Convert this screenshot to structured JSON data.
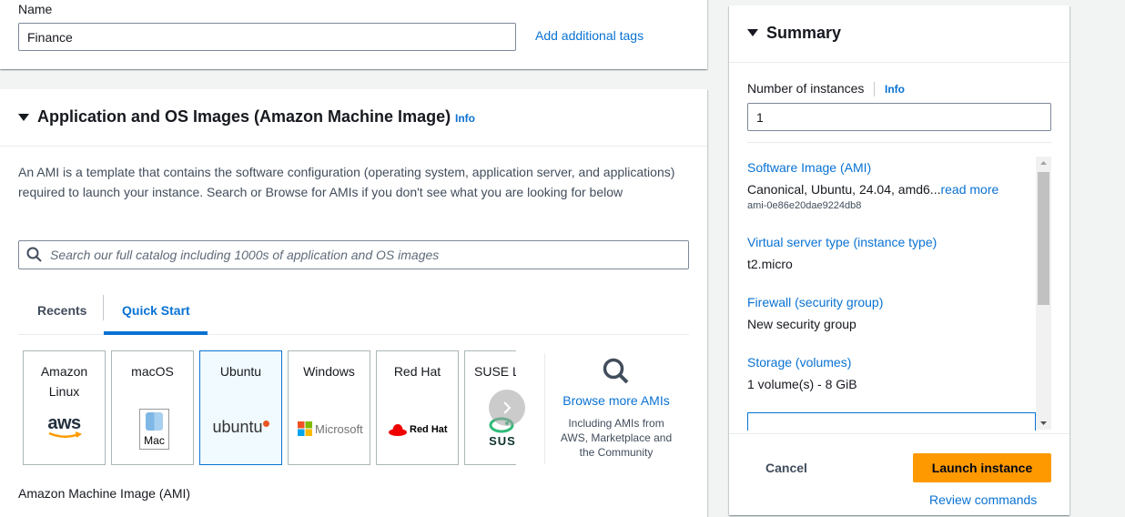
{
  "name_section": {
    "label": "Name",
    "value": "Finance",
    "add_tags": "Add additional tags"
  },
  "ami_section": {
    "title": "Application and OS Images (Amazon Machine Image)",
    "info": "Info",
    "description": "An AMI is a template that contains the software configuration (operating system, application server, and applications) required to launch your instance. Search or Browse for AMIs if you don't see what you are looking for below",
    "search_placeholder": "Search our full catalog including 1000s of application and OS images",
    "tabs": [
      {
        "label": "Recents"
      },
      {
        "label": "Quick Start"
      }
    ],
    "tiles": [
      {
        "name": "Amazon Linux",
        "logo": "aws"
      },
      {
        "name": "macOS",
        "logo": "Mac"
      },
      {
        "name": "Ubuntu",
        "logo": "ubuntu"
      },
      {
        "name": "Windows",
        "logo": "Microsoft"
      },
      {
        "name": "Red Hat",
        "logo": "Red Hat"
      },
      {
        "name": "SUSE Li",
        "logo": "SUS"
      }
    ],
    "browse": {
      "label": "Browse more AMIs",
      "sub": "Including AMIs from AWS, Marketplace and the Community"
    },
    "bottom_label": "Amazon Machine Image (AMI)"
  },
  "summary": {
    "title": "Summary",
    "instances_label": "Number of instances",
    "instances_info": "Info",
    "instances_value": "1",
    "items": [
      {
        "label": "Software Image (AMI)",
        "value": "Canonical, Ubuntu, 24.04, amd6...",
        "more": "read more",
        "sub": "ami-0e86e20dae9224db8"
      },
      {
        "label": "Virtual server type (instance type)",
        "value": "t2.micro"
      },
      {
        "label": "Firewall (security group)",
        "value": "New security group"
      },
      {
        "label": "Storage (volumes)",
        "value": "1 volume(s) - 8 GiB"
      }
    ],
    "cancel": "Cancel",
    "launch": "Launch instance",
    "review": "Review commands"
  },
  "colors": {
    "accent": "#0972d3",
    "launch": "#ff9900"
  }
}
